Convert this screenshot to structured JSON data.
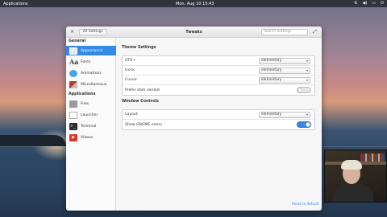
{
  "panel": {
    "applications_label": "Applications",
    "clock": "Mon, Aug 10   15:43",
    "tray_icons": [
      "network-icon",
      "volume-icon",
      "battery-icon",
      "power-icon"
    ]
  },
  "window": {
    "title": "Tweaks",
    "back_label": "All Settings",
    "search_placeholder": "Search Settings",
    "close_icon": "×",
    "maximize_icon": "⤢"
  },
  "sidebar": {
    "general_header": "General",
    "general_items": [
      {
        "label": "Appearance",
        "icon": "appearance-icon",
        "color": "#e9e9e9",
        "active": true
      },
      {
        "label": "Fonts",
        "icon": "fonts-icon",
        "color": "#333333",
        "active": false
      },
      {
        "label": "Animations",
        "icon": "animations-icon",
        "color": "#4aa3df",
        "active": false
      },
      {
        "label": "Miscellaneous",
        "icon": "miscellaneous-icon",
        "color": "#c0392b",
        "active": false
      }
    ],
    "applications_header": "Applications",
    "application_items": [
      {
        "label": "Files",
        "icon": "files-icon",
        "color": "#9a9a9a"
      },
      {
        "label": "Launcher",
        "icon": "launcher-icon",
        "color": "#ffffff"
      },
      {
        "label": "Terminal",
        "icon": "terminal-icon",
        "color": "#2b2b2b"
      },
      {
        "label": "Videos",
        "icon": "videos-icon",
        "color": "#d9362b"
      }
    ]
  },
  "theme_settings": {
    "header": "Theme Settings",
    "gtk_label": "GTK+",
    "gtk_value": "elementary",
    "icons_label": "Icons",
    "icons_value": "elementary",
    "cursor_label": "Cursor",
    "cursor_value": "elementary",
    "prefer_dark_label": "Prefer dark variant",
    "prefer_dark_on": false
  },
  "window_controls": {
    "header": "Window Controls",
    "layout_label": "Layout",
    "layout_value": "elementary",
    "gnome_menu_label": "Show GNOME menu",
    "gnome_menu_on": true
  },
  "reset_label": "Reset to default",
  "accent_color": "#3689e6"
}
